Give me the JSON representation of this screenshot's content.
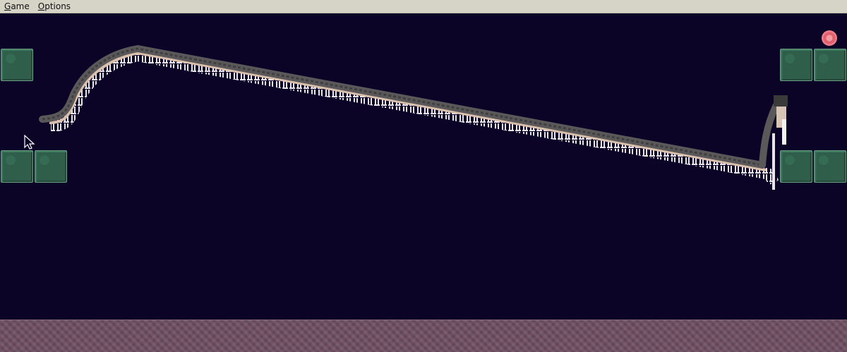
{
  "menu": {
    "game_label": "Game",
    "game_mnemonic": "G",
    "game_rest": "ame",
    "options_label": "Options",
    "options_mnemonic": "O",
    "options_rest": "ptions"
  },
  "colors": {
    "background": "#0b0427",
    "block": "#2f5f4a",
    "gem": "#e0606e",
    "floor": "#6e4f62",
    "worm_body": "#5a5858",
    "worm_legs": "#e8e4ea"
  },
  "icons": {
    "cursor": "arrow-cursor-icon",
    "gem": "pink-gem-icon",
    "block": "green-stone-block"
  }
}
